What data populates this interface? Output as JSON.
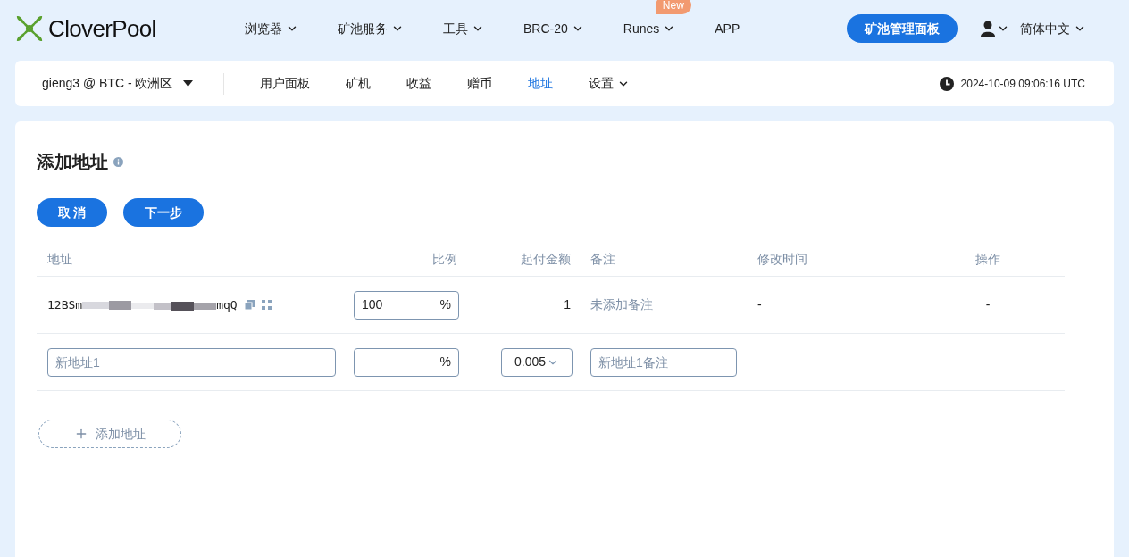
{
  "brand": {
    "name": "CloverPool"
  },
  "top_nav": [
    {
      "label": "浏览器",
      "dropdown": true
    },
    {
      "label": "矿池服务",
      "dropdown": true
    },
    {
      "label": "工具",
      "dropdown": true
    },
    {
      "label": "BRC-20",
      "dropdown": true
    },
    {
      "label": "Runes",
      "dropdown": true,
      "badge": "New"
    },
    {
      "label": "APP",
      "dropdown": false
    }
  ],
  "dashboard_button": "矿池管理面板",
  "language": "简体中文",
  "account_selector": "gieng3 @ BTC - 欧洲区",
  "sub_nav": [
    {
      "label": "用户面板",
      "selected": false,
      "dropdown": false
    },
    {
      "label": "矿机",
      "selected": false,
      "dropdown": false
    },
    {
      "label": "收益",
      "selected": false,
      "dropdown": false
    },
    {
      "label": "赠币",
      "selected": false,
      "dropdown": false
    },
    {
      "label": "地址",
      "selected": true,
      "dropdown": false
    },
    {
      "label": "设置",
      "selected": false,
      "dropdown": true
    }
  ],
  "timestamp": "2024-10-09 09:06:16 UTC",
  "page_title": "添加地址",
  "buttons": [
    "取 消",
    "下一步"
  ],
  "table": {
    "columns": [
      "地址",
      "比例",
      "起付金额",
      "备注",
      "修改时间",
      "操作"
    ],
    "existing_row": {
      "address_start": "12BSm",
      "address_end": "mqQ",
      "ratio": "100",
      "ratio_unit": "%",
      "min_payment": "1",
      "note": "未添加备注",
      "modified": "-",
      "action": "-"
    },
    "new_row": {
      "address_placeholder": "新地址1",
      "ratio_unit": "%",
      "min_payment": "0.005",
      "note_placeholder": "新地址1备注"
    }
  },
  "add_button": "添加地址"
}
